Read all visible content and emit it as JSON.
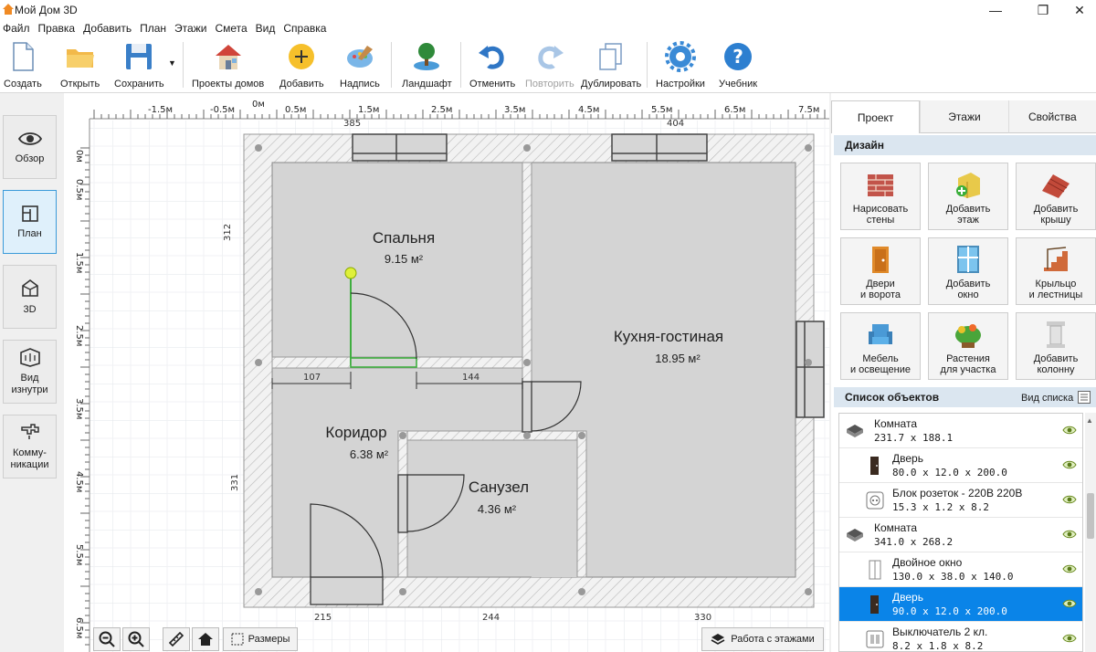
{
  "window": {
    "title": "Мой Дом 3D"
  },
  "menu": [
    "Файл",
    "Правка",
    "Добавить",
    "План",
    "Этажи",
    "Смета",
    "Вид",
    "Справка"
  ],
  "toolbar": {
    "create": "Создать",
    "open": "Открыть",
    "save": "Сохранить",
    "projects": "Проекты домов",
    "add": "Добавить",
    "label": "Надпись",
    "landscape": "Ландшафт",
    "undo": "Отменить",
    "redo": "Повторить",
    "duplicate": "Дублировать",
    "settings": "Настройки",
    "tutorial": "Учебник"
  },
  "leftbar": {
    "overview": "Обзор",
    "plan": "План",
    "view3d": "3D",
    "inside1": "Вид",
    "inside2": "изнутри",
    "comm1": "Комму-",
    "comm2": "никации"
  },
  "ruler": {
    "top": [
      "-1.5м",
      "-0.5м",
      "0м",
      "0.5м",
      "1.5м",
      "2.5м",
      "3.5м",
      "4.5м",
      "5.5м",
      "6.5м",
      "7.5м"
    ],
    "left": [
      "0м",
      "0.5м",
      "1.5м",
      "2.5м",
      "3.5м",
      "4.5м",
      "5.5м",
      "6.5м"
    ]
  },
  "plan": {
    "rooms": [
      {
        "name": "Спальня",
        "area": "9.15 м²"
      },
      {
        "name": "Кухня-гостиная",
        "area": "18.95 м²"
      },
      {
        "name": "Коридор",
        "area": "6.38 м²"
      },
      {
        "name": "Санузел",
        "area": "4.36 м²"
      }
    ],
    "dims": {
      "d107": "107",
      "d144": "144",
      "d312": "312",
      "d331": "331",
      "d215": "215",
      "d244": "244",
      "d330": "330",
      "d385": "385",
      "d404": "404"
    }
  },
  "canvas_buttons": {
    "sizes": "Размеры",
    "floors": "Работа с этажами"
  },
  "panel": {
    "tabs": [
      "Проект",
      "Этажи",
      "Свойства"
    ],
    "design_title": "Дизайн",
    "design": [
      [
        "Нарисовать",
        "стены"
      ],
      [
        "Добавить",
        "этаж"
      ],
      [
        "Добавить",
        "крышу"
      ],
      [
        "Двери",
        "и ворота"
      ],
      [
        "Добавить",
        "окно"
      ],
      [
        "Крыльцо",
        "и лестницы"
      ],
      [
        "Мебель",
        "и освещение"
      ],
      [
        "Растения",
        "для участка"
      ],
      [
        "Добавить",
        "колонну"
      ]
    ],
    "list_title": "Список объектов",
    "list_view": "Вид списка",
    "objects": [
      {
        "name": "Комната",
        "dim": "231.7 x 188.1"
      },
      {
        "name": "Дверь",
        "dim": "80.0 x 12.0 x 200.0"
      },
      {
        "name": "Блок розеток - 220В 220В",
        "dim": "15.3 x 1.2 x 8.2"
      },
      {
        "name": "Комната",
        "dim": "341.0 x 268.2"
      },
      {
        "name": "Двойное окно",
        "dim": "130.0 x 38.0 x 140.0"
      },
      {
        "name": "Дверь",
        "dim": "90.0 x 12.0 x 200.0"
      },
      {
        "name": "Выключатель 2 кл.",
        "dim": "8.2 x 1.8 x 8.2"
      }
    ]
  }
}
